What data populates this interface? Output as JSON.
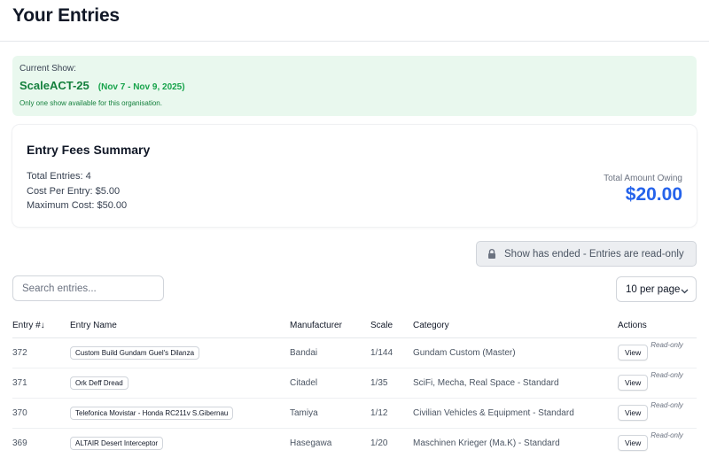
{
  "page": {
    "title": "Your Entries"
  },
  "show": {
    "label": "Current Show:",
    "name": "ScaleACT-25",
    "dates": "(Nov 7 - Nov 9, 2025)",
    "note": "Only one show available for this organisation."
  },
  "fees": {
    "title": "Entry Fees Summary",
    "total_entries": "Total Entries: 4",
    "cost_per_entry": "Cost Per Entry: $5.00",
    "maximum_cost": "Maximum Cost: $50.00",
    "owing_label": "Total Amount Owing",
    "owing_amount": "$20.00"
  },
  "banner": {
    "text": "Show has ended - Entries are read-only",
    "icon": "lock-icon"
  },
  "search": {
    "placeholder": "Search entries...",
    "value": ""
  },
  "pagination": {
    "per_page": "10 per page"
  },
  "table": {
    "headers": {
      "entry_no": "Entry #↓",
      "entry_name": "Entry Name",
      "manufacturer": "Manufacturer",
      "scale": "Scale",
      "category": "Category",
      "actions": "Actions"
    },
    "view_label": "View",
    "readonly_label": "Read-only",
    "rows": [
      {
        "entry_no": "372",
        "name": "Custom Build Gundam Guel's Dilanza",
        "manufacturer": "Bandai",
        "scale": "1/144",
        "category": "Gundam Custom (Master)"
      },
      {
        "entry_no": "371",
        "name": "Ork Deff Dread",
        "manufacturer": "Citadel",
        "scale": "1/35",
        "category": "SciFi, Mecha, Real Space - Standard"
      },
      {
        "entry_no": "370",
        "name": "Telefonica Movistar - Honda RC211v S.Gibernau",
        "manufacturer": "Tamiya",
        "scale": "1/12",
        "category": "Civilian Vehicles & Equipment - Standard"
      },
      {
        "entry_no": "369",
        "name": "ALTAIR Desert Interceptor",
        "manufacturer": "Hasegawa",
        "scale": "1/20",
        "category": "Maschinen Krieger (Ma.K) - Standard"
      }
    ]
  },
  "colors": {
    "show_bg": "#e9f8ee",
    "show_green": "#15803d",
    "owing_blue": "#2563eb",
    "banner_bg": "#eceef1"
  }
}
